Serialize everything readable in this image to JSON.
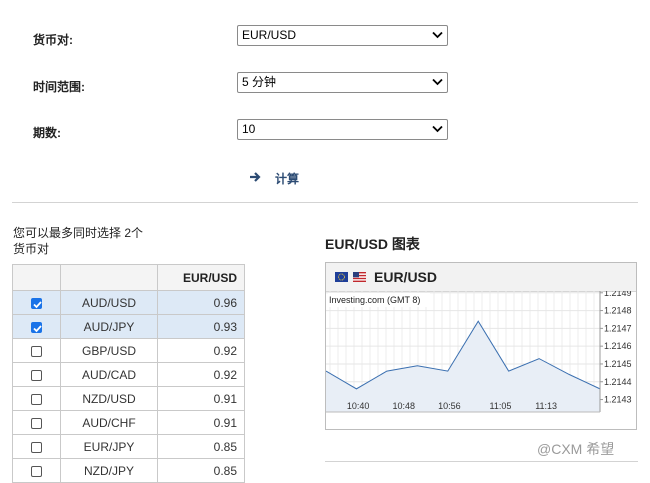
{
  "form": {
    "currency_pair": {
      "label": "货币对:",
      "value": "EUR/USD"
    },
    "time_frame": {
      "label": "时间范围:",
      "value": "5 分钟"
    },
    "periods": {
      "label": "期数:",
      "value": "10"
    },
    "calculate_label": "计算"
  },
  "selection_note": "您可以最多同时选择 2个货币对",
  "table": {
    "header": [
      "",
      "",
      "EUR/USD"
    ],
    "rows": [
      {
        "checked": true,
        "pair": "AUD/USD",
        "value": "0.96"
      },
      {
        "checked": true,
        "pair": "AUD/JPY",
        "value": "0.93"
      },
      {
        "checked": false,
        "pair": "GBP/USD",
        "value": "0.92"
      },
      {
        "checked": false,
        "pair": "AUD/CAD",
        "value": "0.92"
      },
      {
        "checked": false,
        "pair": "NZD/USD",
        "value": "0.91"
      },
      {
        "checked": false,
        "pair": "AUD/CHF",
        "value": "0.91"
      },
      {
        "checked": false,
        "pair": "EUR/JPY",
        "value": "0.85"
      },
      {
        "checked": false,
        "pair": "NZD/JPY",
        "value": "0.85"
      }
    ]
  },
  "chart_panel": {
    "title": "EUR/USD 图表",
    "pair": "EUR/USD",
    "flags": [
      "eu-flag-icon",
      "us-flag-icon"
    ]
  },
  "chart_data": {
    "type": "area",
    "source_label": "Investing.com (GMT 8)",
    "x": [
      "10:36",
      "10:42",
      "10:48",
      "10:54",
      "11:00",
      "11:04",
      "11:08",
      "11:14",
      "11:20",
      "11:24"
    ],
    "values": [
      1.21446,
      1.21436,
      1.21446,
      1.21449,
      1.21446,
      1.21474,
      1.21446,
      1.21453,
      1.21444,
      1.21436
    ],
    "x_tick_labels": [
      "10:40",
      "10:48",
      "10:56",
      "11:05",
      "11:13"
    ],
    "y_tick_labels": [
      "1.2149",
      "1.2148",
      "1.2147",
      "1.2146",
      "1.2145",
      "1.2144",
      "1.2143"
    ],
    "y_ticks": [
      1.2149,
      1.2148,
      1.2147,
      1.2146,
      1.2145,
      1.2144,
      1.2143
    ],
    "ylim": [
      1.21423,
      1.21491
    ],
    "grid": true,
    "line_color": "#3a6fb0",
    "fill_color": "#e8eef6"
  },
  "watermark": "@CXM 希望"
}
